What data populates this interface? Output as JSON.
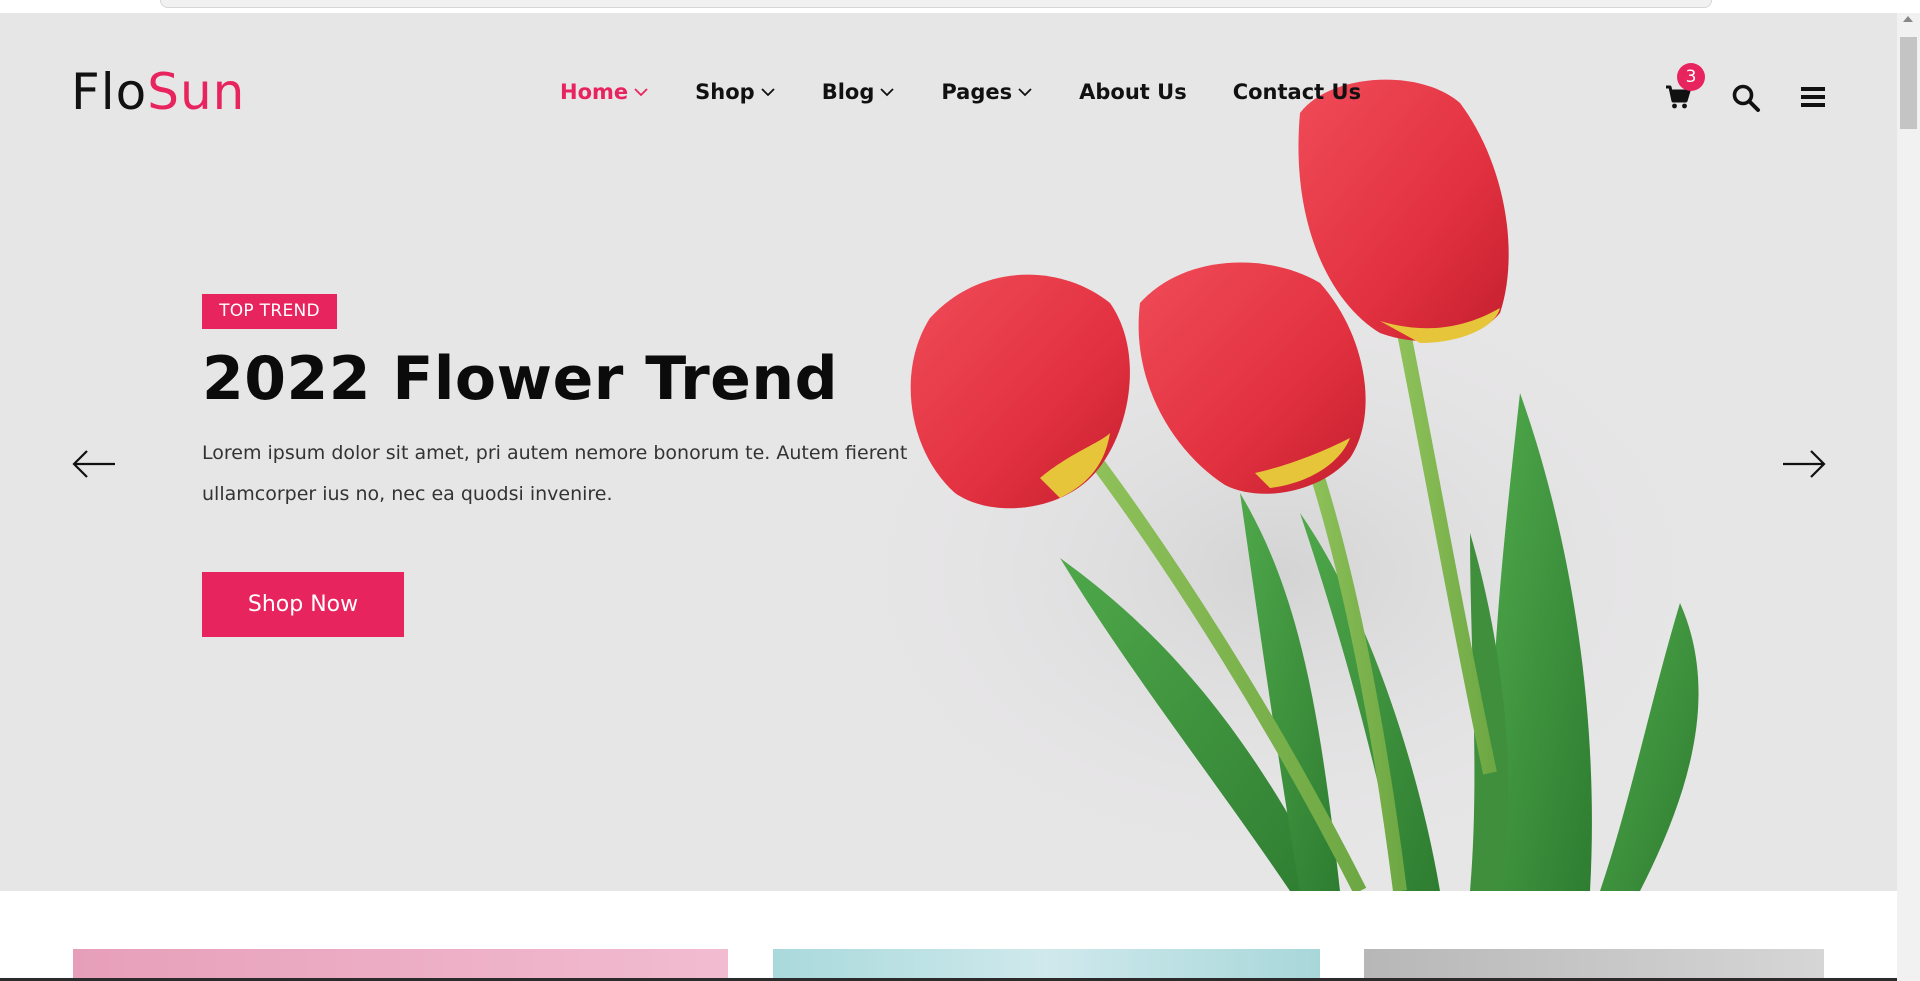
{
  "brand": {
    "part1": "Flo",
    "part2": "Sun"
  },
  "nav": {
    "items": [
      {
        "label": "Home",
        "dropdown": true,
        "active": true
      },
      {
        "label": "Shop",
        "dropdown": true,
        "active": false
      },
      {
        "label": "Blog",
        "dropdown": true,
        "active": false
      },
      {
        "label": "Pages",
        "dropdown": true,
        "active": false
      },
      {
        "label": "About Us",
        "dropdown": false,
        "active": false
      },
      {
        "label": "Contact Us",
        "dropdown": false,
        "active": false
      }
    ]
  },
  "header_icons": {
    "cart_icon": "cart-icon",
    "cart_count": "3",
    "search_icon": "search-icon",
    "menu_icon": "hamburger-menu-icon"
  },
  "hero": {
    "tag": "TOP TREND",
    "title": "2022 Flower Trend",
    "description": "Lorem ipsum dolor sit amet, pri autem nemore bonorum te. Autem fierent ullamcorper ius no, nec ea quodsi invenire.",
    "cta_label": "Shop Now",
    "prev_icon": "arrow-left-icon",
    "next_icon": "arrow-right-icon"
  },
  "colors": {
    "accent": "#e8245e",
    "hero_bg": "#e7e6e7",
    "text_dark": "#111111"
  }
}
